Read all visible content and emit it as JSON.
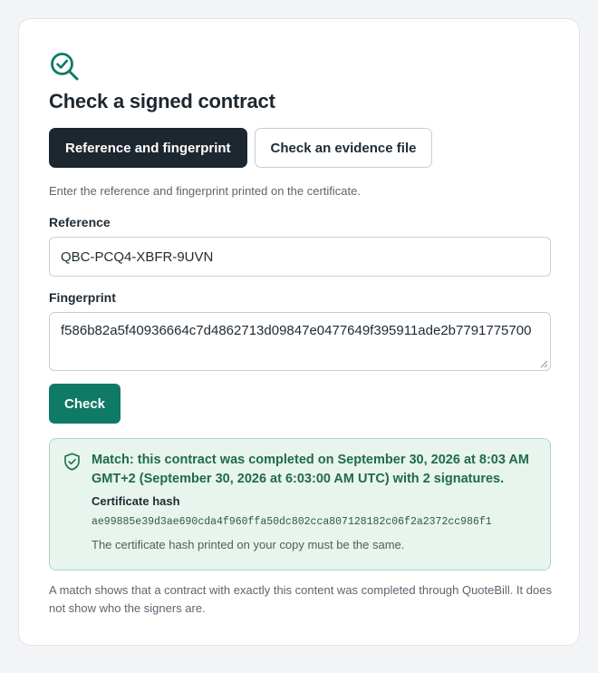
{
  "page": {
    "title": "Check a signed contract",
    "icon": "magnifier-check-icon",
    "accent_color": "#0f7a65"
  },
  "tabs": [
    {
      "label": "Reference and fingerprint",
      "active": true
    },
    {
      "label": "Check an evidence file",
      "active": false
    }
  ],
  "form": {
    "hint": "Enter the reference and fingerprint printed on the certificate.",
    "reference_label": "Reference",
    "reference_value": "QBC-PCQ4-XBFR-9UVN",
    "fingerprint_label": "Fingerprint",
    "fingerprint_value": "f586b82a5f40936664c7d4862713d09847e0477649f395911ade2b7791775700",
    "check_label": "Check"
  },
  "result": {
    "icon": "shield-check-icon",
    "status": "match",
    "message": "Match: this contract was completed on September 30, 2026 at 8:03 AM GMT+2 (September 30, 2026 at 6:03:00 AM UTC) with 2 signatures.",
    "hash_label": "Certificate hash",
    "hash_value": "ae99885e39d3ae690cda4f960ffa50dc802cca807128182c06f2a2372cc986f1",
    "hash_note": "The certificate hash printed on your copy must be the same."
  },
  "footnote": "A match shows that a contract with exactly this content was completed through QuoteBill. It does not show who the signers are."
}
